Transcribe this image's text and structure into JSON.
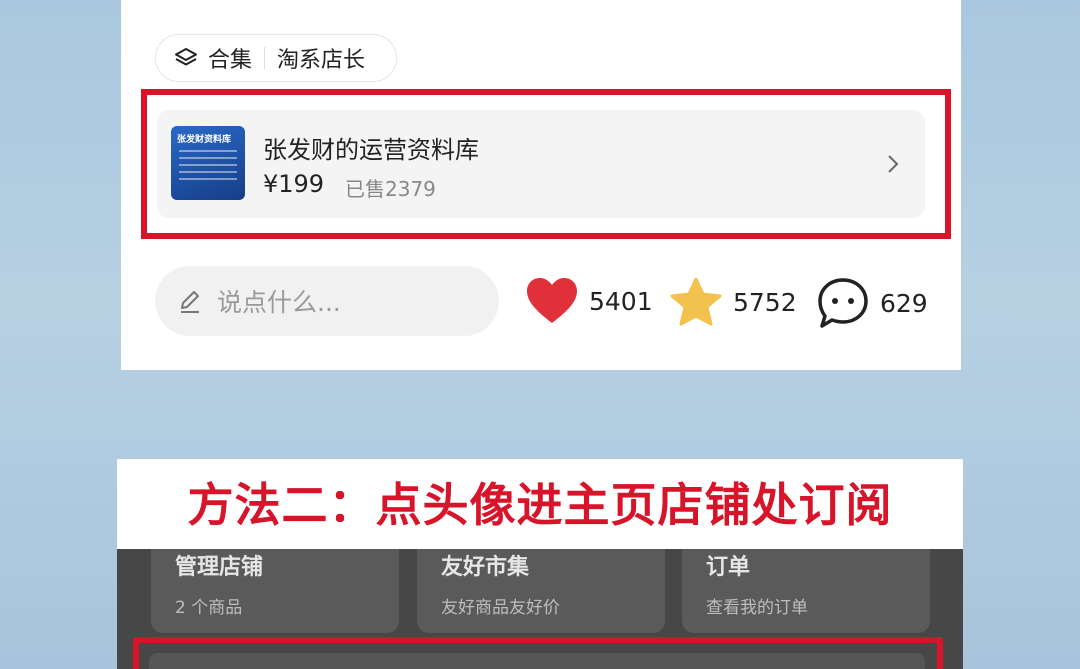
{
  "post": {
    "title_cut": "淘系店长",
    "collection": {
      "icon": "layers-icon",
      "label": "合集",
      "name": "淘系店长"
    },
    "product": {
      "thumb_text": "张发财资料库",
      "title": "张发财的运营资料库",
      "price": "¥199",
      "sold": "已售2379"
    },
    "comment_placeholder": "说点什么...",
    "stats": {
      "likes": "5401",
      "favorites": "5752",
      "comments": "629"
    }
  },
  "banner": {
    "text": "方法二：点头像进主页店铺处订阅"
  },
  "shop_tiles": [
    {
      "title": "管理店铺",
      "subtitle": "2 个商品"
    },
    {
      "title": "友好市集",
      "subtitle": "友好商品友好价"
    },
    {
      "title": "订单",
      "subtitle": "查看我的订单"
    }
  ],
  "colors": {
    "accent_red": "#d7142a",
    "heart": "#e0303a",
    "star": "#f2c14e"
  }
}
